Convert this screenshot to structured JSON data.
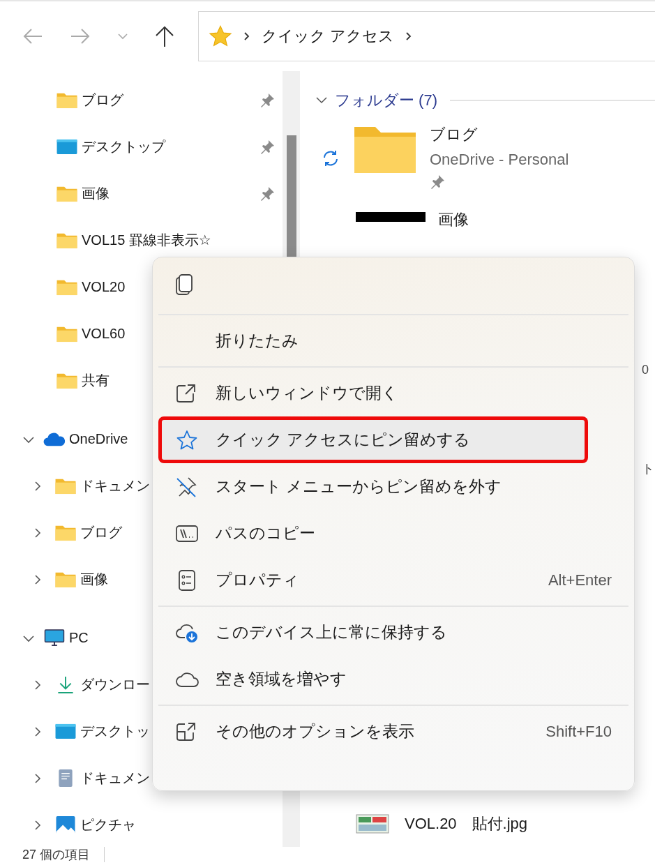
{
  "nav": {
    "back": {
      "disabled": true
    },
    "forward": {
      "disabled": true
    },
    "address": [
      {
        "label": "クイック アクセス"
      }
    ]
  },
  "sidebar": {
    "sections": [
      {
        "items": [
          {
            "label": "ブログ",
            "kind": "folder",
            "pinned": true
          },
          {
            "label": "デスクトップ",
            "kind": "desktop",
            "pinned": true
          },
          {
            "label": "画像",
            "kind": "folder",
            "pinned": true
          },
          {
            "label": "VOL15 罫線非表示☆",
            "kind": "folder",
            "pinned": false
          },
          {
            "label": "VOL20",
            "kind": "folder",
            "pinned": false
          },
          {
            "label": "VOL60",
            "kind": "folder",
            "pinned": false
          },
          {
            "label": "共有",
            "kind": "folder",
            "pinned": false
          }
        ]
      },
      {
        "items": [
          {
            "label": "OneDrive",
            "kind": "onedrive",
            "expanded": true,
            "children": [
              {
                "label": "ドキュメン",
                "kind": "folder",
                "expanded": false
              },
              {
                "label": "ブログ",
                "kind": "folder",
                "expanded": false
              },
              {
                "label": "画像",
                "kind": "folder",
                "expanded": false
              }
            ]
          }
        ]
      },
      {
        "items": [
          {
            "label": "PC",
            "kind": "pc",
            "expanded": true,
            "children": [
              {
                "label": "ダウンロー",
                "kind": "download",
                "expanded": false
              },
              {
                "label": "デスクトッ",
                "kind": "desktop",
                "expanded": false
              },
              {
                "label": "ドキュメン",
                "kind": "document",
                "expanded": false
              },
              {
                "label": "ピクチャ",
                "kind": "picture",
                "expanded": false
              }
            ]
          }
        ]
      }
    ]
  },
  "content": {
    "group": {
      "title": "フォルダー (7)",
      "expanded": true
    },
    "folders": [
      {
        "name": "ブログ",
        "location": "OneDrive - Personal",
        "pinned": true,
        "synced": true,
        "kind": "folder"
      },
      {
        "name": "画像",
        "kind": "image"
      }
    ],
    "edge_texts": [
      "0",
      "ト"
    ],
    "file": {
      "name": "VOL.20　貼付.jpg"
    }
  },
  "context_menu": {
    "items": [
      {
        "kind": "copy"
      },
      {
        "kind": "separator"
      },
      {
        "kind": "collapse",
        "label": "折りたたみ",
        "selected": false,
        "annotated": false
      },
      {
        "kind": "separator"
      },
      {
        "kind": "openwindow",
        "label": "新しいウィンドウで開く",
        "selected": false,
        "annotated": false
      },
      {
        "kind": "pin",
        "label": "クイック アクセスにピン留めする",
        "selected": true,
        "annotated": true
      },
      {
        "kind": "unpin",
        "label": "スタート メニューからピン留めを外す",
        "selected": false,
        "annotated": false
      },
      {
        "kind": "copypath",
        "label": "パスのコピー",
        "selected": false,
        "annotated": false
      },
      {
        "kind": "properties",
        "label": "プロパティ",
        "shortcut": "Alt+Enter",
        "selected": false,
        "annotated": false
      },
      {
        "kind": "separator"
      },
      {
        "kind": "keeponline",
        "label": "このデバイス上に常に保持する",
        "selected": false,
        "annotated": false
      },
      {
        "kind": "freespace",
        "label": "空き領域を増やす",
        "selected": false,
        "annotated": false
      },
      {
        "kind": "separator"
      },
      {
        "kind": "moreoptions",
        "label": "その他のオプションを表示",
        "shortcut": "Shift+F10",
        "selected": false,
        "annotated": false
      }
    ]
  },
  "status_bar": {
    "count": "27 個の項目"
  }
}
